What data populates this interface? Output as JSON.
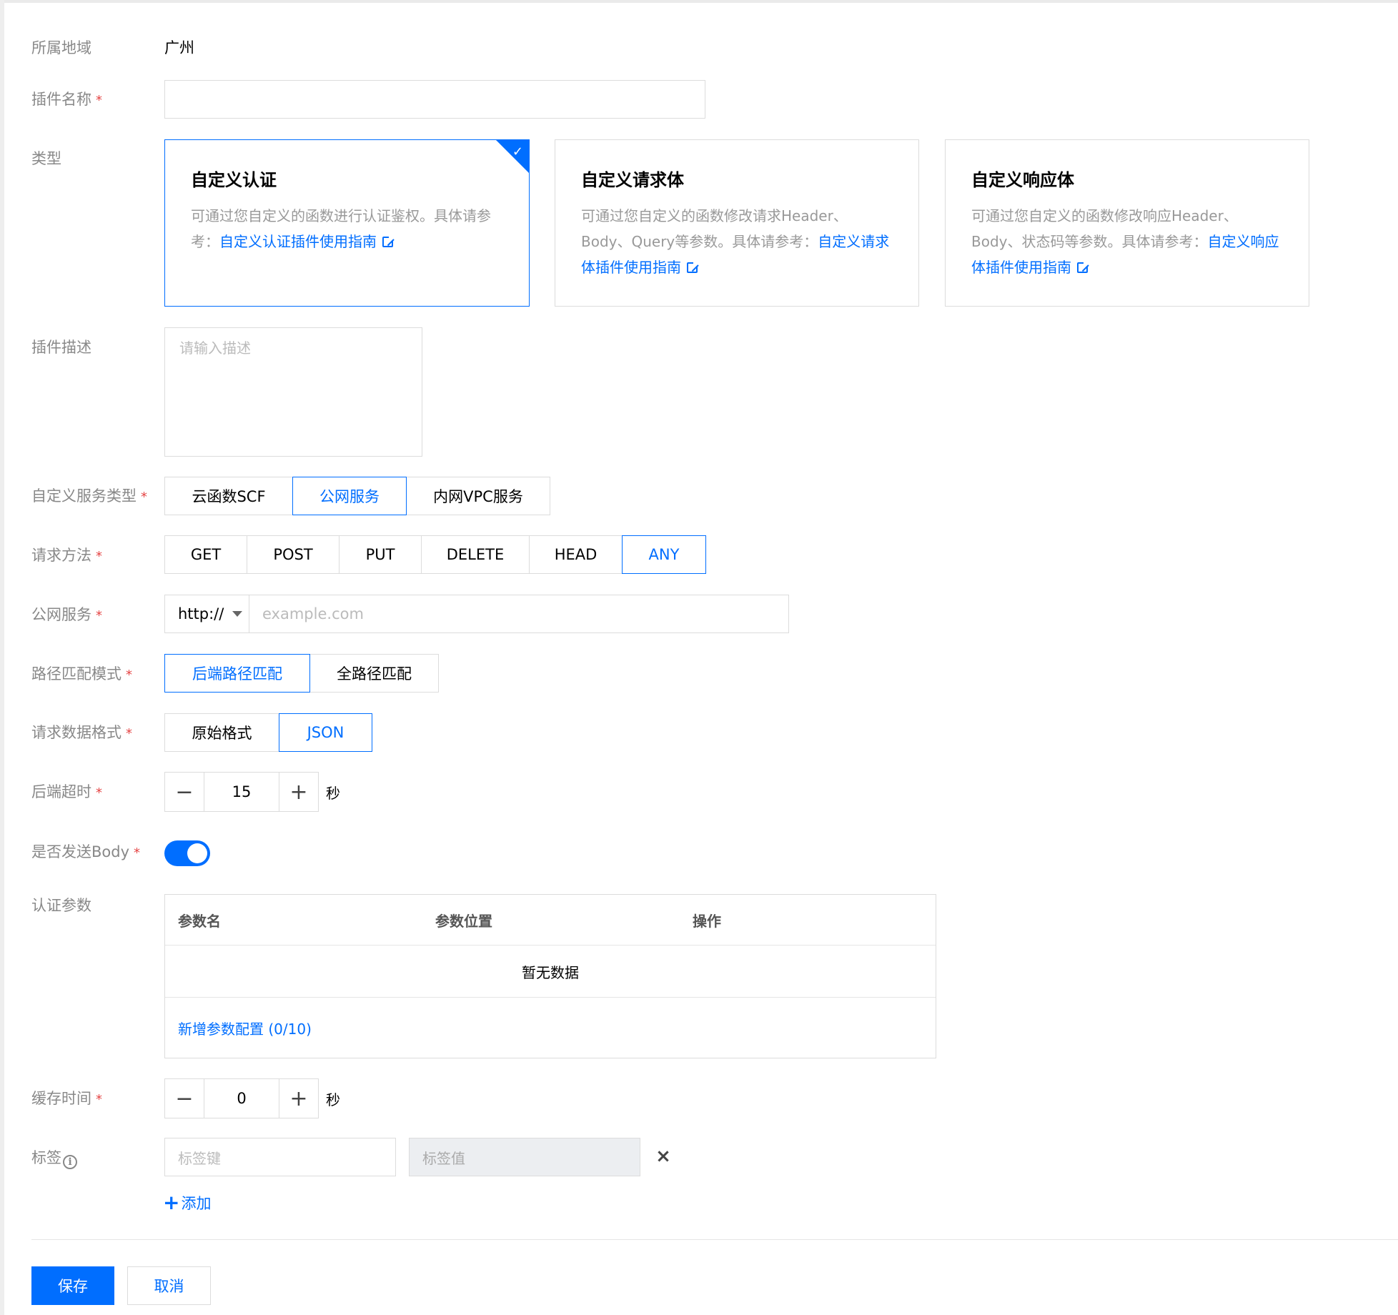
{
  "region": {
    "label": "所属地域",
    "value": "广州"
  },
  "plugin_name": {
    "label": "插件名称",
    "required": "*",
    "value": ""
  },
  "type": {
    "label": "类型",
    "cards": [
      {
        "title": "自定义认证",
        "desc": "可通过您自定义的函数进行认证鉴权。具体请参考：",
        "link": "自定义认证插件使用指南",
        "selected": true
      },
      {
        "title": "自定义请求体",
        "desc": "可通过您自定义的函数修改请求Header、Body、Query等参数。具体请参考：",
        "link": "自定义请求体插件使用指南",
        "selected": false
      },
      {
        "title": "自定义响应体",
        "desc": "可通过您自定义的函数修改响应Header、Body、状态码等参数。具体请参考：",
        "link": "自定义响应体插件使用指南",
        "selected": false
      }
    ]
  },
  "description": {
    "label": "插件描述",
    "placeholder": "请输入描述"
  },
  "service_type": {
    "label": "自定义服务类型",
    "required": "*",
    "options": [
      "云函数SCF",
      "公网服务",
      "内网VPC服务"
    ],
    "selected": "公网服务"
  },
  "method": {
    "label": "请求方法",
    "required": "*",
    "options": [
      "GET",
      "POST",
      "PUT",
      "DELETE",
      "HEAD",
      "ANY"
    ],
    "selected": "ANY"
  },
  "public_service": {
    "label": "公网服务",
    "required": "*",
    "protocol": "http://",
    "placeholder": "example.com"
  },
  "path_match": {
    "label": "路径匹配模式",
    "required": "*",
    "options": [
      "后端路径匹配",
      "全路径匹配"
    ],
    "selected": "后端路径匹配"
  },
  "data_format": {
    "label": "请求数据格式",
    "required": "*",
    "options": [
      "原始格式",
      "JSON"
    ],
    "selected": "JSON"
  },
  "timeout": {
    "label": "后端超时",
    "required": "*",
    "value": "15",
    "unit": "秒"
  },
  "send_body": {
    "label": "是否发送Body",
    "required": "*",
    "on": true
  },
  "auth_params": {
    "label": "认证参数",
    "columns": [
      "参数名",
      "参数位置",
      "操作"
    ],
    "empty": "暂无数据",
    "add": "新增参数配置 (0/10)"
  },
  "cache_time": {
    "label": "缓存时间",
    "required": "*",
    "value": "0",
    "unit": "秒"
  },
  "tags": {
    "label": "标签",
    "key_placeholder": "标签键",
    "value_placeholder": "标签值",
    "add": "添加"
  },
  "actions": {
    "save": "保存",
    "cancel": "取消"
  },
  "colors": {
    "accent": "#006eff",
    "required": "#e54545",
    "label": "#888888"
  }
}
